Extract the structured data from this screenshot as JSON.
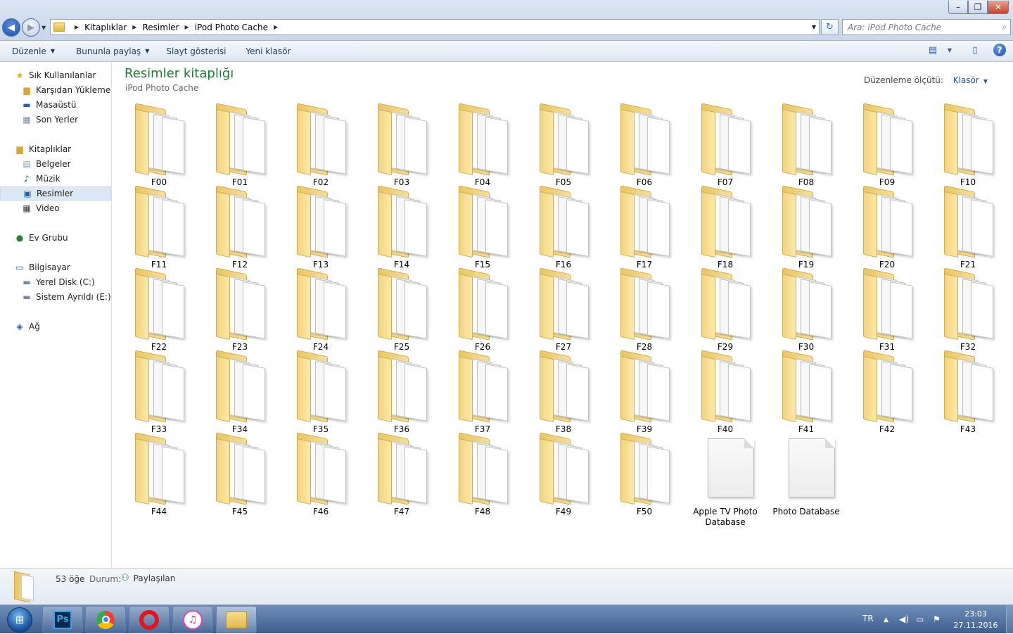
{
  "window": {
    "minimize": "–",
    "maximize": "❐",
    "close": "✕"
  },
  "address": {
    "crumbs": [
      "Kitaplıklar",
      "Resimler",
      "iPod Photo Cache"
    ],
    "search_placeholder": "Ara: iPod Photo Cache"
  },
  "toolbar": {
    "organize": "Düzenle",
    "share": "Bununla paylaş",
    "slideshow": "Slayt gösterisi",
    "new_folder": "Yeni klasör"
  },
  "nav": {
    "favorites": "Sık Kullanılanlar",
    "downloads": "Karşıdan Yüklemeler",
    "desktop": "Masaüstü",
    "recent": "Son Yerler",
    "libraries": "Kitaplıklar",
    "documents": "Belgeler",
    "music": "Müzik",
    "pictures": "Resimler",
    "video": "Video",
    "homegroup": "Ev Grubu",
    "computer": "Bilgisayar",
    "local_disk": "Yerel Disk (C:)",
    "system_reserved": "Sistem Ayrıldı (E:)",
    "network": "Ağ"
  },
  "content": {
    "title": "Resimler kitaplığı",
    "subtitle": "iPod Photo Cache",
    "arrange_label": "Düzenleme ölçütü:",
    "arrange_value": "Klasör",
    "items": [
      {
        "name": "F00",
        "type": "folder"
      },
      {
        "name": "F01",
        "type": "folder"
      },
      {
        "name": "F02",
        "type": "folder"
      },
      {
        "name": "F03",
        "type": "folder"
      },
      {
        "name": "F04",
        "type": "folder"
      },
      {
        "name": "F05",
        "type": "folder"
      },
      {
        "name": "F06",
        "type": "folder"
      },
      {
        "name": "F07",
        "type": "folder"
      },
      {
        "name": "F08",
        "type": "folder"
      },
      {
        "name": "F09",
        "type": "folder"
      },
      {
        "name": "F10",
        "type": "folder"
      },
      {
        "name": "F11",
        "type": "folder"
      },
      {
        "name": "F12",
        "type": "folder"
      },
      {
        "name": "F13",
        "type": "folder"
      },
      {
        "name": "F14",
        "type": "folder"
      },
      {
        "name": "F15",
        "type": "folder"
      },
      {
        "name": "F16",
        "type": "folder"
      },
      {
        "name": "F17",
        "type": "folder"
      },
      {
        "name": "F18",
        "type": "folder"
      },
      {
        "name": "F19",
        "type": "folder"
      },
      {
        "name": "F20",
        "type": "folder"
      },
      {
        "name": "F21",
        "type": "folder"
      },
      {
        "name": "F22",
        "type": "folder"
      },
      {
        "name": "F23",
        "type": "folder"
      },
      {
        "name": "F24",
        "type": "folder"
      },
      {
        "name": "F25",
        "type": "folder"
      },
      {
        "name": "F26",
        "type": "folder"
      },
      {
        "name": "F27",
        "type": "folder"
      },
      {
        "name": "F28",
        "type": "folder"
      },
      {
        "name": "F29",
        "type": "folder"
      },
      {
        "name": "F30",
        "type": "folder"
      },
      {
        "name": "F31",
        "type": "folder"
      },
      {
        "name": "F32",
        "type": "folder"
      },
      {
        "name": "F33",
        "type": "folder"
      },
      {
        "name": "F34",
        "type": "folder"
      },
      {
        "name": "F35",
        "type": "folder"
      },
      {
        "name": "F36",
        "type": "folder"
      },
      {
        "name": "F37",
        "type": "folder"
      },
      {
        "name": "F38",
        "type": "folder"
      },
      {
        "name": "F39",
        "type": "folder"
      },
      {
        "name": "F40",
        "type": "folder"
      },
      {
        "name": "F41",
        "type": "folder"
      },
      {
        "name": "F42",
        "type": "folder"
      },
      {
        "name": "F43",
        "type": "folder"
      },
      {
        "name": "F44",
        "type": "folder"
      },
      {
        "name": "F45",
        "type": "folder"
      },
      {
        "name": "F46",
        "type": "folder"
      },
      {
        "name": "F47",
        "type": "folder"
      },
      {
        "name": "F48",
        "type": "folder"
      },
      {
        "name": "F49",
        "type": "folder"
      },
      {
        "name": "F50",
        "type": "folder"
      },
      {
        "name": "Apple TV Photo Database",
        "type": "file"
      },
      {
        "name": "Photo Database",
        "type": "file"
      }
    ]
  },
  "details": {
    "count": "53 öğe",
    "status_label": "Durum:",
    "status_value": "Paylaşılan"
  },
  "taskbar": {
    "apps": [
      "photoshop-icon",
      "chrome-icon",
      "opera-icon",
      "itunes-icon",
      "explorer-icon"
    ],
    "ps_label": "Ps",
    "lang": "TR",
    "time": "23:03",
    "date": "27.11.2016"
  }
}
